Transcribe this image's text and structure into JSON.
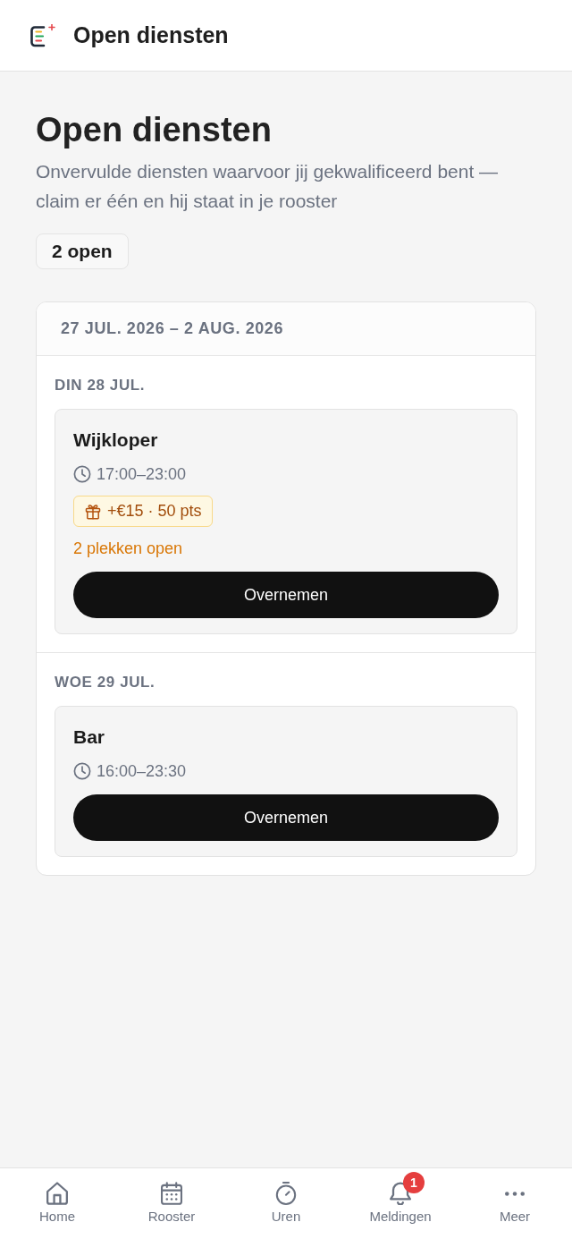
{
  "app_bar": {
    "title": "Open diensten"
  },
  "page": {
    "title": "Open diensten",
    "subtitle": "Onvervulde diensten waarvoor jij gekwalificeerd bent — claim er één en hij staat in je rooster",
    "count_chip": "2 open"
  },
  "week": {
    "range": "27 JUL. 2026 – 2 AUG. 2026",
    "days": [
      {
        "label": "DIN 28 JUL.",
        "shifts": [
          {
            "title": "Wijkloper",
            "time": "17:00–23:00",
            "bonus": "+€15 · 50 pts",
            "spots": "2 plekken open",
            "action": "Overnemen"
          }
        ]
      },
      {
        "label": "WOE 29 JUL.",
        "shifts": [
          {
            "title": "Bar",
            "time": "16:00–23:30",
            "action": "Overnemen"
          }
        ]
      }
    ]
  },
  "bottom_nav": [
    {
      "kind": "home",
      "label": "Home",
      "selected": false
    },
    {
      "kind": "calendar",
      "label": "Rooster",
      "selected": false
    },
    {
      "kind": "timer",
      "label": "Uren",
      "selected": false
    },
    {
      "kind": "bell",
      "label": "Meldingen",
      "badge": "1",
      "selected": false
    },
    {
      "kind": "more",
      "label": "Meer",
      "selected": false
    }
  ]
}
